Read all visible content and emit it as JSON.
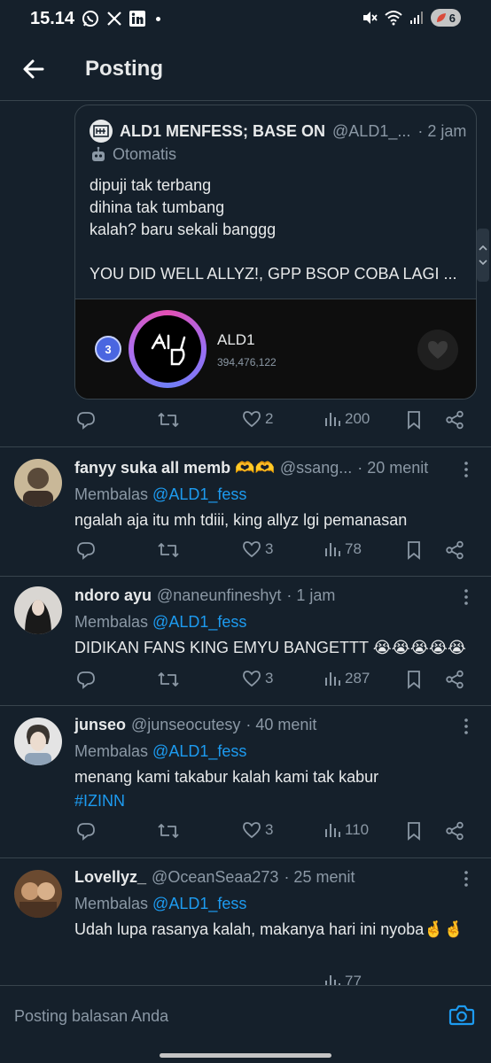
{
  "status_bar": {
    "time": "15.14",
    "battery": "6"
  },
  "header": {
    "title": "Posting"
  },
  "quoted_post": {
    "name": "ALD1 MENFESS; BASE ON",
    "handle": "@ALD1_...",
    "time": "· 2 jam",
    "automated_label": "Otomatis",
    "text": "dipuji tak terbang\ndihina tak tumbang\nkalah? baru sekali banggg\n\nYOU DID WELL ALLYZ!, GPP BSOP COBA LAGI ...",
    "card": {
      "rank": "3",
      "artist": "ALD1",
      "count": "394,476,122"
    },
    "stats": {
      "likes": "2",
      "views": "200"
    }
  },
  "replies": [
    {
      "name": "fanyy suka all memb 🫶🫶",
      "handle": "@ssang...",
      "time": "· 20 menit",
      "reply_prefix": "Membalas",
      "reply_to": "@ALD1_fess",
      "text": "ngalah aja itu mh tdiii, king allyz lgi pemanasan",
      "likes": "3",
      "views": "78"
    },
    {
      "name": "ndoro ayu",
      "handle": "@naneunfineshyt",
      "time": "· 1 jam",
      "reply_prefix": "Membalas",
      "reply_to": "@ALD1_fess",
      "text": "DIDIKAN FANS KING EMYU BANGETTT 😭😭😭😭😭",
      "likes": "3",
      "views": "287"
    },
    {
      "name": "junseo",
      "handle": "@junseocutesy",
      "time": "· 40 menit",
      "reply_prefix": "Membalas",
      "reply_to": "@ALD1_fess",
      "text": "menang kami takabur kalah kami tak kabur",
      "hashtag": "#IZINN",
      "likes": "3",
      "views": "110"
    },
    {
      "name": "Lovellyz_",
      "handle": "@OceanSeaa273",
      "time": "· 25 menit",
      "reply_prefix": "Membalas",
      "reply_to": "@ALD1_fess",
      "text": "Udah lupa rasanya kalah, makanya hari ini nyoba🤞🤞",
      "views": "77"
    }
  ],
  "composer": {
    "placeholder": "Posting balasan Anda"
  },
  "colors": {
    "background": "#15202b",
    "accent": "#1d9bf0",
    "muted": "#8b98a5",
    "border": "#38444d"
  }
}
